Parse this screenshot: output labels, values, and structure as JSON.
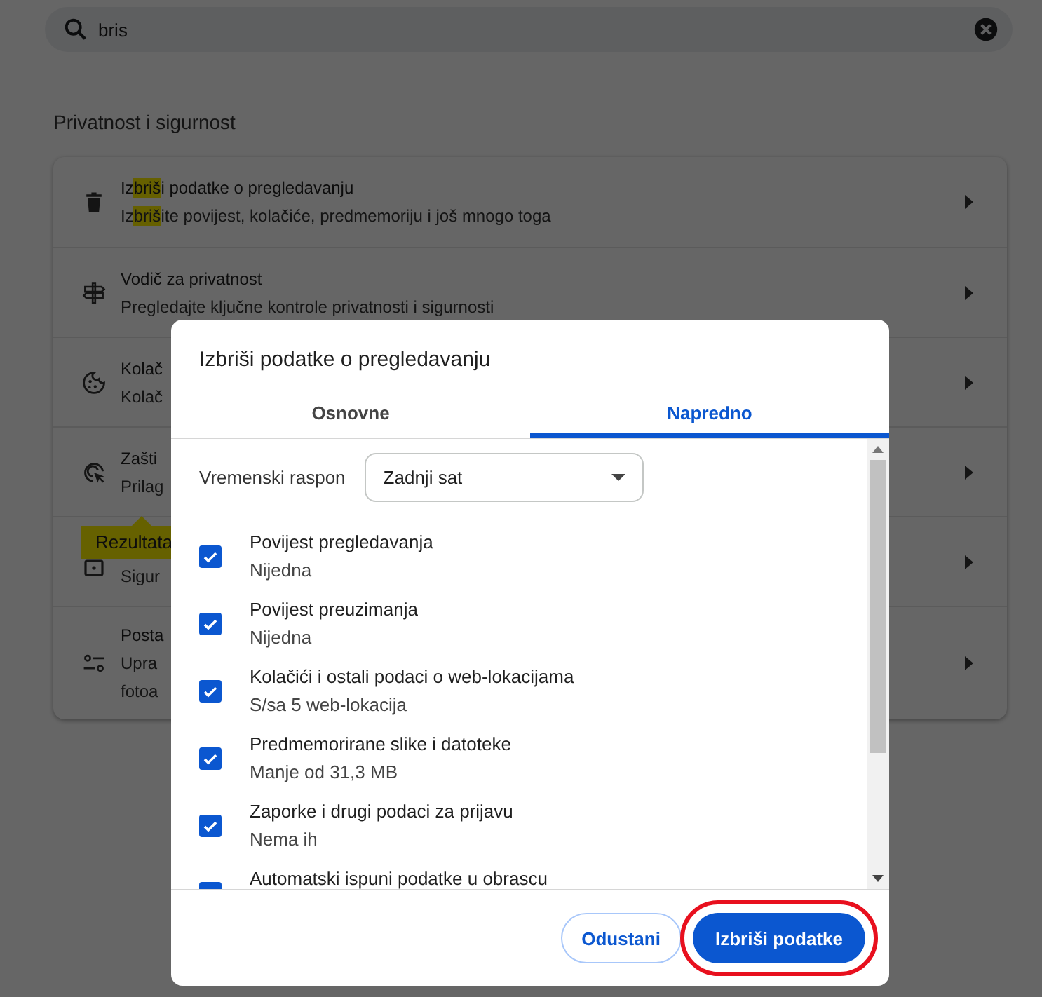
{
  "search": {
    "value": "bris"
  },
  "section_title": "Privatnost i sigurnost",
  "settings_rows": [
    {
      "title": [
        {
          "text": "Iz",
          "highlight": false
        },
        {
          "text": "briš",
          "highlight": true
        },
        {
          "text": "i podatke o pregledavanju",
          "highlight": false
        }
      ],
      "lines": [
        [
          {
            "text": "Iz",
            "highlight": false
          },
          {
            "text": "briš",
            "highlight": true
          },
          {
            "text": "ite povijest, kolačiće, predmemoriju i još mnogo toga",
            "highlight": false
          }
        ]
      ]
    },
    {
      "title": [
        {
          "text": "Vodič za privatnost",
          "highlight": false
        }
      ],
      "lines": [
        [
          {
            "text": "Pregledajte ključne kontrole privatnosti i sigurnosti",
            "highlight": false
          }
        ]
      ]
    },
    {
      "title": [
        {
          "text": "Kolač",
          "highlight": false
        }
      ],
      "lines": [
        [
          {
            "text": "Kolač",
            "highlight": false
          }
        ]
      ]
    },
    {
      "title": [
        {
          "text": "Zašti",
          "highlight": false
        }
      ],
      "lines": [
        [
          {
            "text": "Prilag",
            "highlight": false
          }
        ]
      ]
    },
    {
      "lines": [
        [
          {
            "text": "Sigur",
            "highlight": false
          }
        ]
      ]
    },
    {
      "title": [
        {
          "text": "Posta",
          "highlight": false
        }
      ],
      "lines": [
        [
          {
            "text": "Upra",
            "highlight": false
          }
        ],
        [
          {
            "text": "fotoa",
            "highlight": false
          }
        ]
      ]
    }
  ],
  "tooltip": {
    "text": "Rezultata"
  },
  "dialog": {
    "title": "Izbriši podatke o pregledavanju",
    "tabs": [
      {
        "label": "Osnovne",
        "selected": false
      },
      {
        "label": "Napredno",
        "selected": true
      }
    ],
    "time_range": {
      "label": "Vremenski raspon",
      "value": "Zadnji sat"
    },
    "options": [
      {
        "title": "Povijest pregledavanja",
        "detail": "Nijedna",
        "checked": true
      },
      {
        "title": "Povijest preuzimanja",
        "detail": "Nijedna",
        "checked": true
      },
      {
        "title": "Kolačići i ostali podaci o web-lokacijama",
        "detail": "S/sa 5 web-lokacija",
        "checked": true
      },
      {
        "title": "Predmemorirane slike i datoteke",
        "detail": "Manje od 31,3 MB",
        "checked": true
      },
      {
        "title": "Zaporke i drugi podaci za prijavu",
        "detail": "Nema ih",
        "checked": true
      },
      {
        "title": "Automatski ispuni podatke u obrascu",
        "checked": true
      }
    ],
    "buttons": [
      {
        "label": "Odustani",
        "kind": "secondary",
        "annotated": false
      },
      {
        "label": "Izbriši podatke",
        "kind": "primary",
        "annotated": true
      }
    ]
  }
}
